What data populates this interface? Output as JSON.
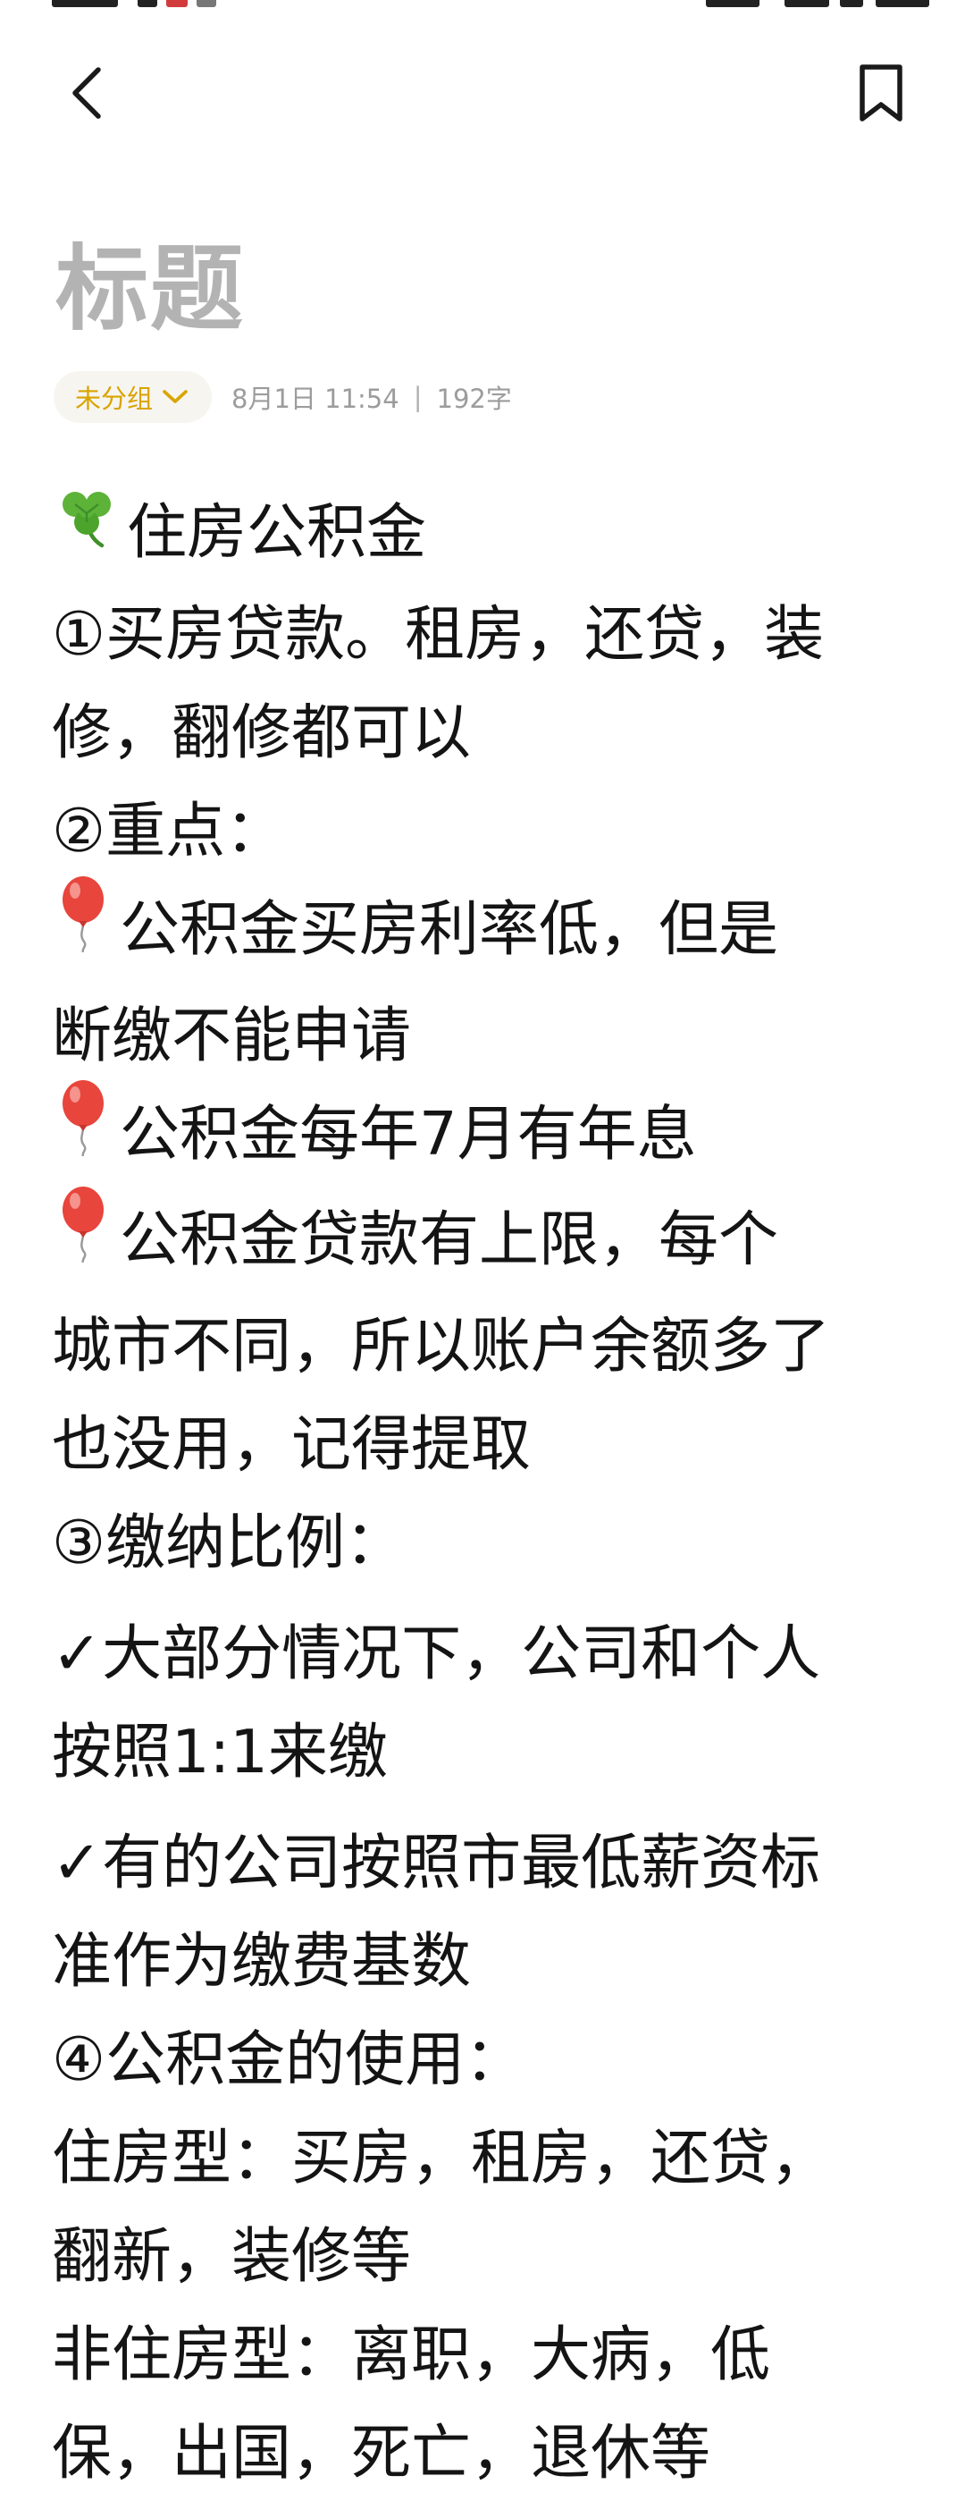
{
  "header": {
    "back_icon": "chevron-left-icon",
    "bookmark_icon": "bookmark-icon"
  },
  "note": {
    "title": "标题",
    "group_label": "未分组",
    "group_icon": "chevron-down-icon",
    "date": "8月1日 11:54",
    "separator": "|",
    "word_count": "192字",
    "accent_color": "#d9a400",
    "lines": [
      {
        "icon": "clover-icon",
        "text": "住房公积金"
      },
      {
        "text": "①买房贷款。租房，还贷，装"
      },
      {
        "text": "修，翻修都可以"
      },
      {
        "text": "②重点："
      },
      {
        "icon": "balloon-icon",
        "text": "公积金买房利率低，但是"
      },
      {
        "text": "断缴不能申请"
      },
      {
        "icon": "balloon-icon",
        "text": "公积金每年7月有年息"
      },
      {
        "icon": "balloon-icon",
        "text": "公积金贷款有上限，每个"
      },
      {
        "text": "城市不同，所以账户余额多了"
      },
      {
        "text": "也没用，记得提取"
      },
      {
        "text": "③缴纳比例："
      },
      {
        "text": "✓大部分情况下，公司和个人",
        "gap": true
      },
      {
        "text": "按照1:1来缴"
      },
      {
        "text": "✓有的公司按照市最低薪资标",
        "gap": true
      },
      {
        "text": "准作为缴费基数"
      },
      {
        "text": "④公积金的使用："
      },
      {
        "text": "住房型：买房，租房，还贷，"
      },
      {
        "text": "翻新，装修等"
      },
      {
        "text": "非住房型：离职，大病，低"
      },
      {
        "text": "保，出国，死亡，退休等"
      }
    ]
  }
}
